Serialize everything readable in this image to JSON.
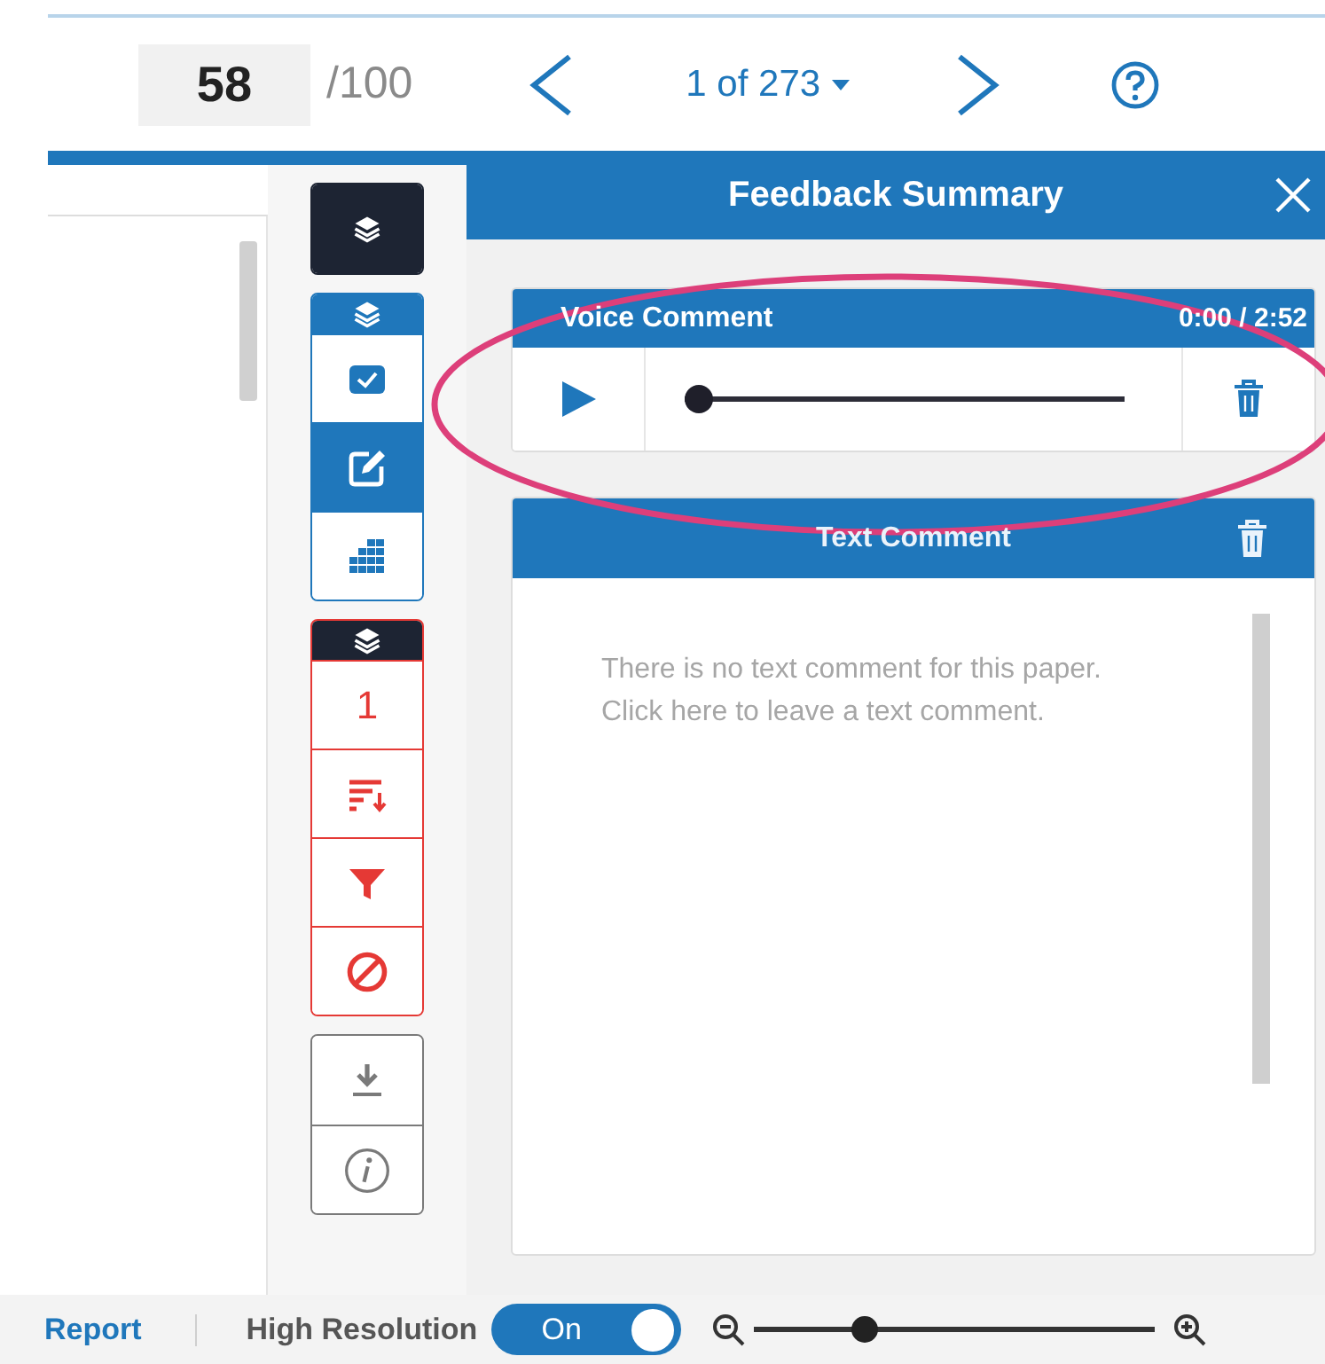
{
  "header": {
    "score": "58",
    "total": "/100",
    "pager": "1 of 273"
  },
  "toolbar": {
    "groups": [
      {
        "color": "#1d2433",
        "buttons": [
          {
            "kind": "layers",
            "selected": true
          }
        ]
      },
      {
        "color": "#1f77bb",
        "header": {
          "color": "#1f77bb"
        },
        "buttons": [
          {
            "kind": "check",
            "selected": false
          },
          {
            "kind": "edit",
            "selected": true
          },
          {
            "kind": "grid",
            "selected": false
          }
        ]
      },
      {
        "color": "#e53935",
        "header": {
          "color": "#1d2433"
        },
        "buttons": [
          {
            "kind": "text",
            "text": "1",
            "selected": false
          },
          {
            "kind": "sort",
            "selected": false
          },
          {
            "kind": "filter",
            "selected": false
          },
          {
            "kind": "ban",
            "selected": false
          }
        ]
      },
      {
        "color": "#7a7a7a",
        "buttons": [
          {
            "kind": "download",
            "selected": false
          },
          {
            "kind": "info",
            "selected": false
          }
        ]
      }
    ]
  },
  "panel": {
    "title": "Feedback Summary",
    "voice_comment": {
      "title": "Voice Comment",
      "time": "0:00 / 2:52",
      "level": 0
    },
    "text_comment": {
      "title": "Text Comment",
      "message": "There is no text comment for this paper. Click here to leave a text comment."
    }
  },
  "status_bar": {
    "link": "Report",
    "label": "High Resolution",
    "toggle": {
      "label": "On",
      "on": true
    },
    "zoom": {
      "level": 0.26
    }
  }
}
